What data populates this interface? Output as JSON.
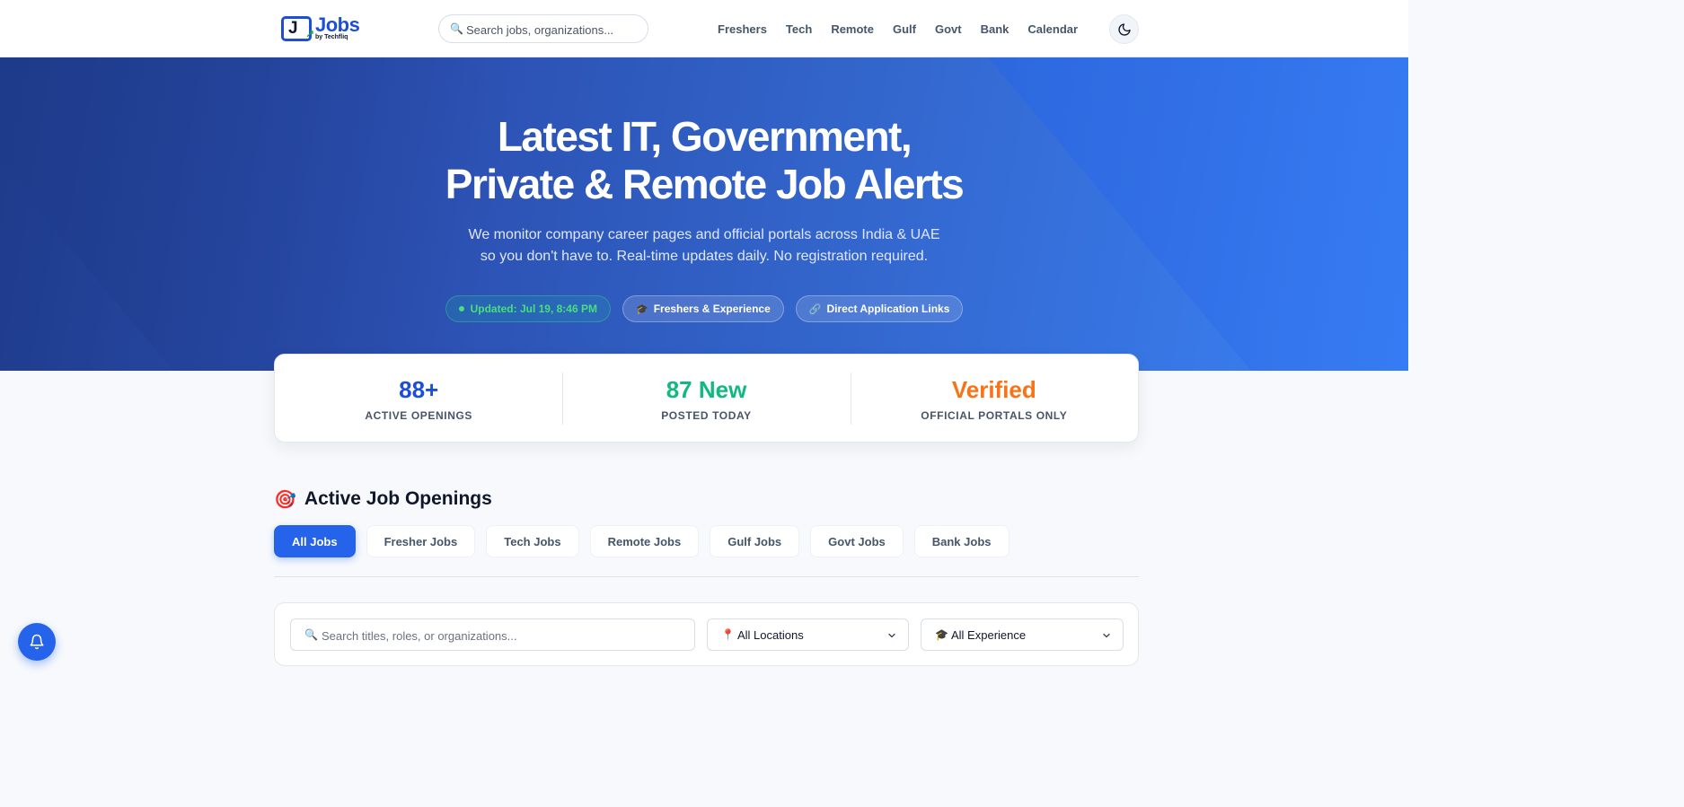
{
  "header": {
    "logo_text": "Jobs",
    "logo_sub": "by Techfliq",
    "search_placeholder": "Search jobs, organizations...",
    "nav": [
      "Freshers",
      "Tech",
      "Remote",
      "Gulf",
      "Govt",
      "Bank",
      "Calendar"
    ],
    "theme_icon": "moon-icon"
  },
  "hero": {
    "title_line1": "Latest IT, Government,",
    "title_line2": "Private & Remote Job Alerts",
    "subtitle_line1": "We monitor company career pages and official portals across India & UAE",
    "subtitle_line2": "so you don't have to. Real-time updates daily. No registration required.",
    "pills": {
      "updated": "Updated: Jul 19, 8:46 PM",
      "experience": "Freshers & Experience",
      "links": "Direct Application Links"
    }
  },
  "stats": [
    {
      "value": "88+",
      "label": "ACTIVE OPENINGS",
      "color": "#1d4ed8"
    },
    {
      "value": "87 New",
      "label": "POSTED TODAY",
      "color": "#10b981"
    },
    {
      "value": "Verified",
      "label": "OFFICIAL PORTALS ONLY",
      "color": "#f97316"
    }
  ],
  "section": {
    "title": "Active Job Openings",
    "icon": "target-icon"
  },
  "tabs": [
    "All Jobs",
    "Fresher Jobs",
    "Tech Jobs",
    "Remote Jobs",
    "Gulf Jobs",
    "Govt Jobs",
    "Bank Jobs"
  ],
  "filters": {
    "search_placeholder": "Search titles, roles, or organizations...",
    "location": "All Locations",
    "experience": "All Experience"
  },
  "colors": {
    "accent": "#2563eb",
    "brand": "#1d4ed8"
  }
}
